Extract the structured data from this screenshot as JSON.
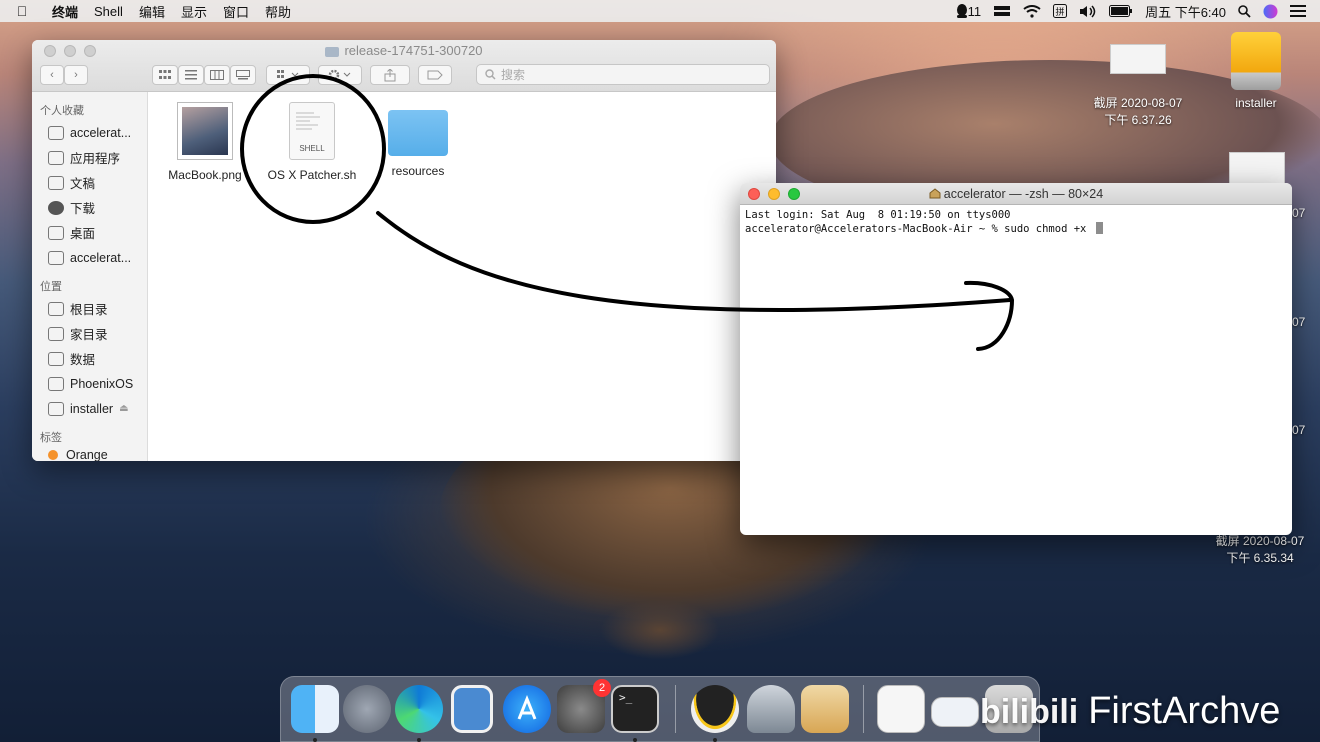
{
  "menubar": {
    "apple": "",
    "app": "终端",
    "items": [
      "Shell",
      "编辑",
      "显示",
      "窗口",
      "帮助"
    ],
    "notification_count": "11",
    "clock": "周五 下午6:40"
  },
  "desktop": {
    "screenshot1": {
      "line1": "截屏 2020-08-07",
      "line2": "下午 6.37.26"
    },
    "installer_label": "installer",
    "cut_text_1": "07",
    "cut_text_2": "07",
    "cut_text_3": "07",
    "screenshot2": {
      "line1": "截屏 2020-08-07",
      "line2": "下午 6.35.34"
    }
  },
  "finder": {
    "title": "release-174751-300720",
    "search_placeholder": "搜索",
    "sidebar": {
      "favorites_header": "个人收藏",
      "favorites": [
        "accelerat...",
        "应用程序",
        "文稿",
        "下载",
        "桌面",
        "accelerat..."
      ],
      "locations_header": "位置",
      "locations": [
        "根目录",
        "家目录",
        "数据",
        "PhoenixOS",
        "installer"
      ],
      "tags_header": "标签",
      "tags_partial": "Orange"
    },
    "files": [
      "MacBook.png",
      "OS X Patcher.sh",
      "resources"
    ],
    "shell_icon_label": "SHELL"
  },
  "terminal": {
    "title": "accelerator — -zsh — 80×24",
    "line1": "Last login: Sat Aug  8 01:19:50 on ttys000",
    "line2": "accelerator@Accelerators-MacBook-Air ~ % sudo chmod +x "
  },
  "dock": {
    "apps": [
      "finder",
      "launchpad",
      "edge",
      "preview",
      "app-store",
      "system-preferences",
      "terminal",
      "qq",
      "disk-utility",
      "archive-utility"
    ],
    "prefs_badge": "2"
  },
  "watermark": {
    "logo": "bilibili",
    "text": "FirstArchve"
  }
}
